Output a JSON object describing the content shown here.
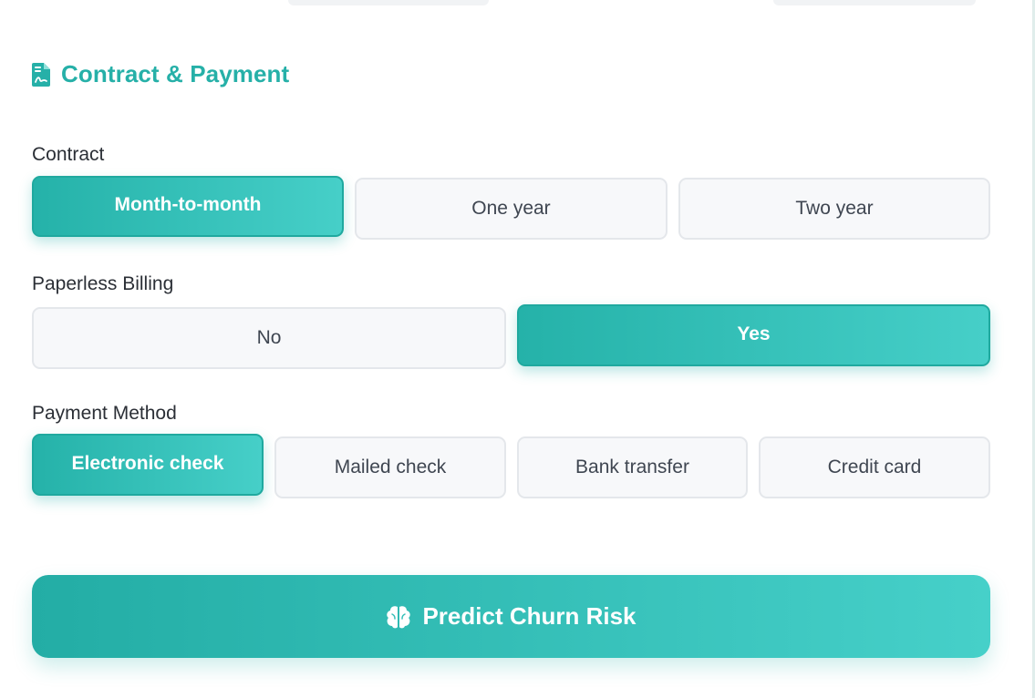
{
  "section": {
    "title": "Contract & Payment",
    "icon": "file-contract-icon"
  },
  "contract": {
    "label": "Contract",
    "options": [
      "Month-to-month",
      "One year",
      "Two year"
    ],
    "selected": "Month-to-month"
  },
  "paperless_billing": {
    "label": "Paperless Billing",
    "options": [
      "No",
      "Yes"
    ],
    "selected": "Yes"
  },
  "payment_method": {
    "label": "Payment Method",
    "options": [
      "Electronic check",
      "Mailed check",
      "Bank transfer",
      "Credit card"
    ],
    "selected": "Electronic check"
  },
  "predict_button": {
    "label": "Predict Churn Risk",
    "icon": "brain-icon"
  },
  "colors": {
    "accent": "#26b0a8",
    "accent_light": "#46cfc8",
    "option_bg": "#f7f8fa",
    "option_border": "#e4e7eb"
  }
}
